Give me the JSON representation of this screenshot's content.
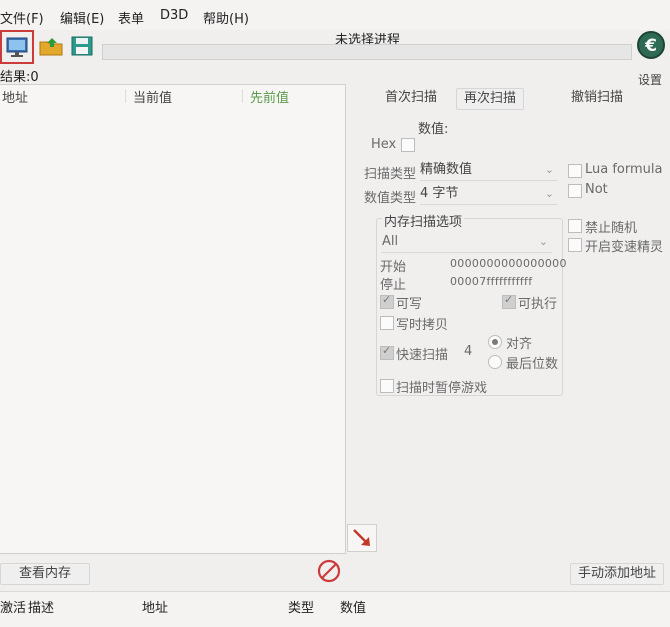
{
  "menu": {
    "file": "文件(F)",
    "edit": "编辑(E)",
    "table": "表单",
    "d3d": "D3D",
    "help": "帮助(H)"
  },
  "header": {
    "process_title": "未选择进程",
    "settings_label": "设置",
    "results": "结果:0"
  },
  "list": {
    "columns": [
      "地址",
      "当前值",
      "先前值"
    ]
  },
  "scan": {
    "first_scan": "首次扫描",
    "next_scan": "再次扫描",
    "undo_scan": "撤销扫描",
    "value_label": "数值:",
    "hex_label": "Hex",
    "scan_type_label": "扫描类型",
    "scan_type_value": "精确数值",
    "value_type_label": "数值类型",
    "value_type_value": "4 字节",
    "lua_formula": "Lua formula",
    "not_label": "Not",
    "disable_random": "禁止随机",
    "speedhack": "开启变速精灵"
  },
  "memory_options": {
    "title": "内存扫描选项",
    "region": "All",
    "start_label": "开始",
    "start_value": "0000000000000000",
    "stop_label": "停止",
    "stop_value": "00007fffffffffff",
    "writable": "可写",
    "executable": "可执行",
    "copy_on_write": "写时拷贝",
    "fast_scan": "快速扫描",
    "fast_scan_value": "4",
    "align": "对齐",
    "last_digits": "最后位数",
    "pause_game": "扫描时暂停游戏"
  },
  "bottom": {
    "view_memory": "查看内存",
    "add_address": "手动添加地址",
    "columns": [
      "激活",
      "描述",
      "地址",
      "类型",
      "数值"
    ]
  },
  "colors": {
    "accent_red": "#cc3b3b",
    "green_header": "#5a9a4a"
  }
}
